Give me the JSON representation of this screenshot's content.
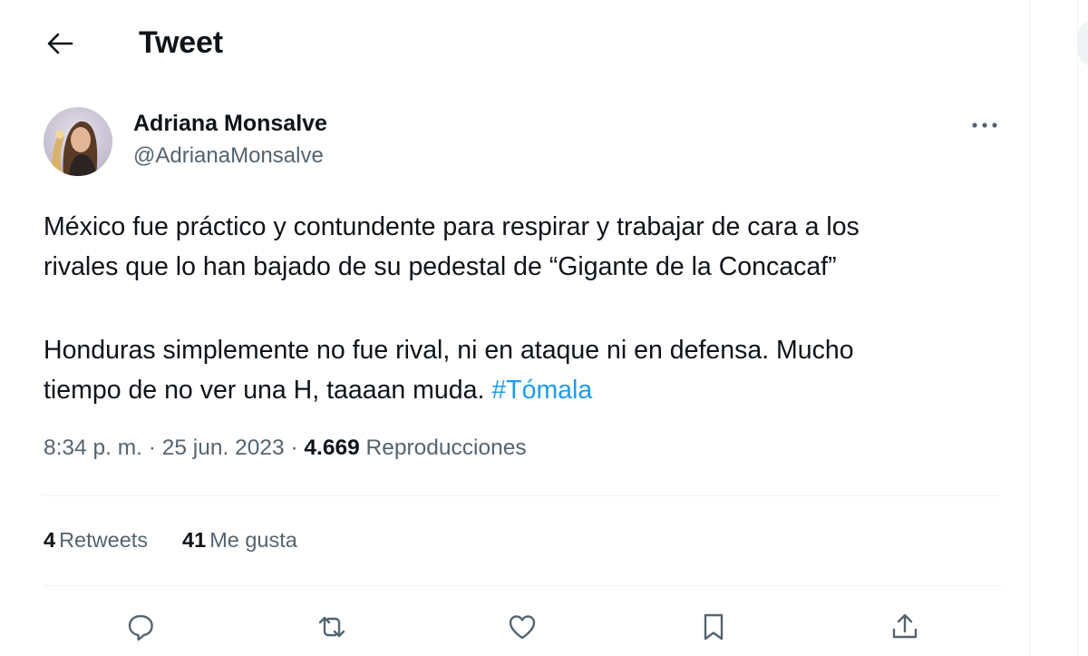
{
  "header": {
    "title": "Tweet",
    "back_icon": "arrow-left-icon"
  },
  "author": {
    "name": "Adriana Monsalve",
    "handle": "@AdrianaMonsalve"
  },
  "tweet": {
    "line1": "México fue práctico y contundente para respirar y trabajar de cara a los",
    "line2": "rivales que lo han bajado de su pedestal de “Gigante de la Concacaf”",
    "line3": "Honduras simplemente no fue rival, ni en ataque ni en defensa. Mucho",
    "line4": "tiempo de no ver una H, taaaan muda.",
    "hashtag": "#Tómala"
  },
  "meta": {
    "time": "8:34 p. m.",
    "sep": "·",
    "date": "25 jun. 2023",
    "views_count": "4.669",
    "views_label": "Reproducciones"
  },
  "stats": {
    "retweets_count": "4",
    "retweets_label": "Retweets",
    "likes_count": "41",
    "likes_label": "Me gusta"
  },
  "actions": [
    "reply-icon",
    "retweet-icon",
    "like-icon",
    "bookmark-icon",
    "share-icon"
  ],
  "colors": {
    "text": "#0f1419",
    "secondary": "#536471",
    "link": "#1d9bf0",
    "border": "#eff3f4"
  }
}
